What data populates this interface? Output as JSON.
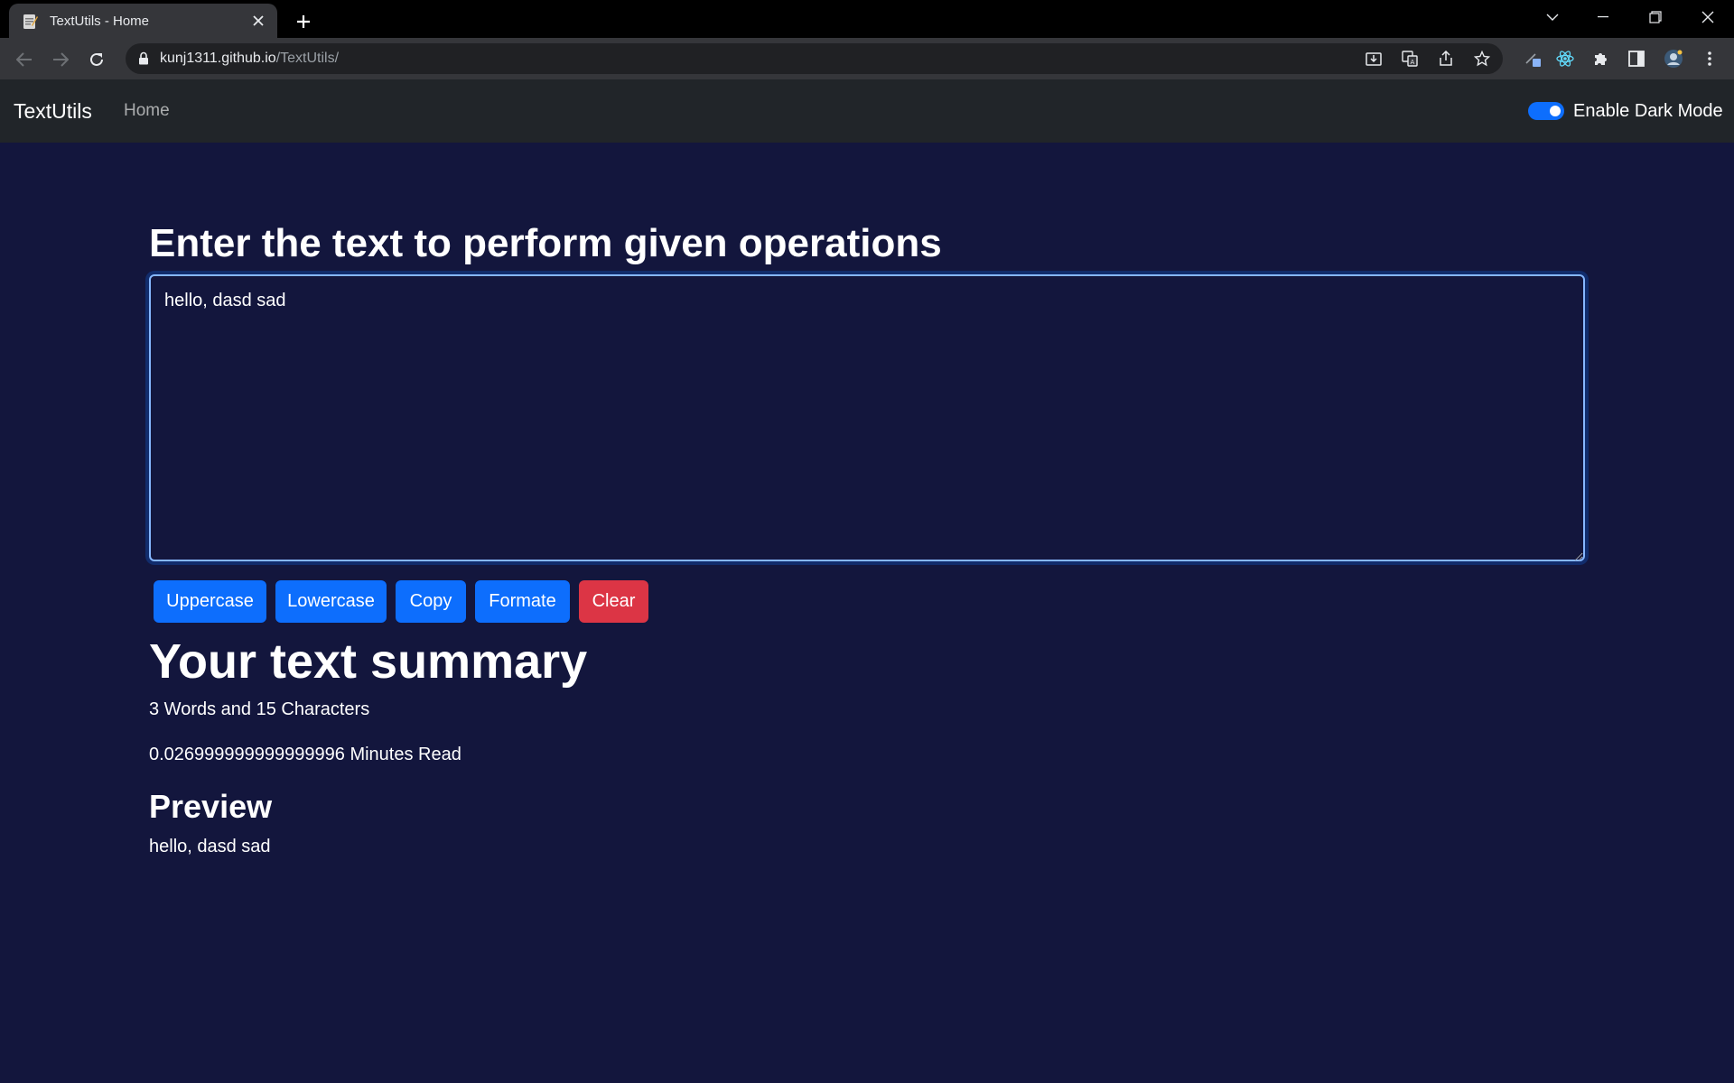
{
  "browser": {
    "tab_title": "TextUtils - Home",
    "url_host": "kunj1311.github.io",
    "url_path": "/TextUtils/"
  },
  "navbar": {
    "brand": "TextUtils",
    "home_link": "Home",
    "dark_mode_label": "Enable Dark Mode",
    "dark_mode_enabled": true
  },
  "main": {
    "heading": "Enter the text to perform given operations",
    "textarea_value": "hello, dasd sad",
    "buttons": {
      "uppercase": "Uppercase",
      "lowercase": "Lowercase",
      "copy": "Copy",
      "formate": "Formate",
      "clear": "Clear"
    }
  },
  "summary": {
    "title": "Your text summary",
    "counts": "3 Words and 15 Characters",
    "read_time": "0.026999999999999996 Minutes Read",
    "preview_title": "Preview",
    "preview_text": "hello, dasd sad"
  },
  "colors": {
    "page_background": "#13163d",
    "navbar_background": "#212529",
    "primary_button": "#0d6efd",
    "danger_button": "#dc3545"
  }
}
